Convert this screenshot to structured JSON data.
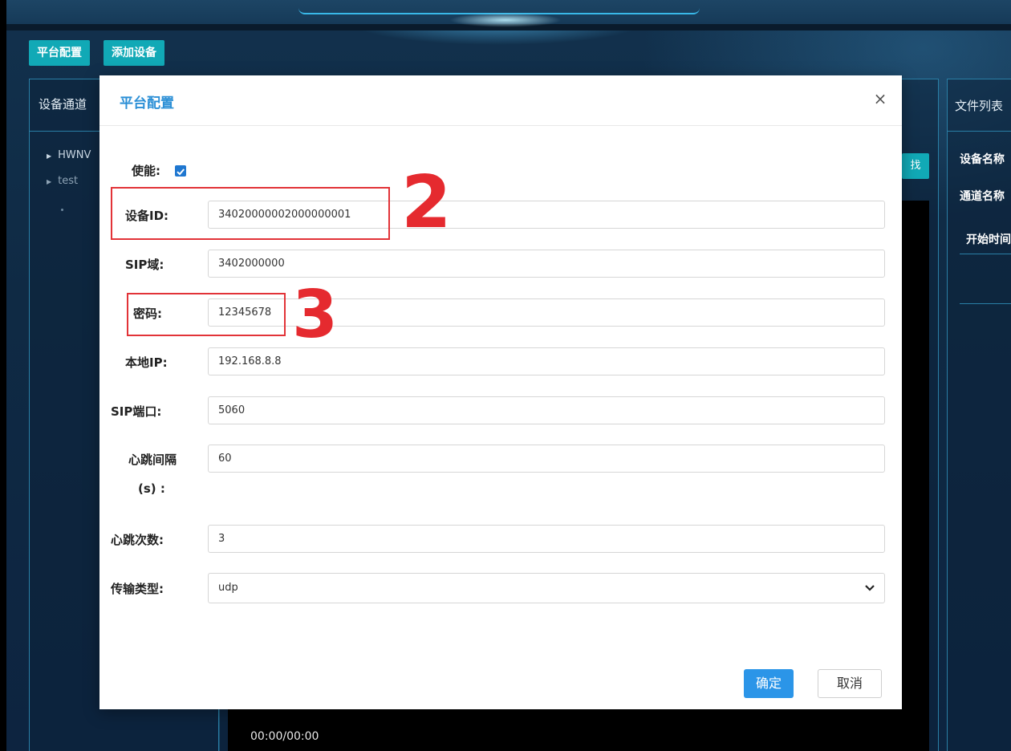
{
  "toolbar": {
    "platform_config": "平台配置",
    "add_device": "添加设备"
  },
  "left_panel": {
    "title": "设备通道",
    "items": [
      "HWNV",
      "test"
    ]
  },
  "right_panel": {
    "title": "文件列表",
    "device_name": "设备名称",
    "channel_name": "通道名称",
    "start_time": "开始时间"
  },
  "search_button": "找",
  "video": {
    "time": "00:00/00:00"
  },
  "modal": {
    "title": "平台配置",
    "close": "×",
    "fields": {
      "enable": {
        "label": "使能:",
        "checked": true
      },
      "device_id": {
        "label": "设备ID:",
        "value": "34020000002000000001"
      },
      "sip_domain": {
        "label": "SIP域:",
        "value": "3402000000"
      },
      "password": {
        "label": "密码:",
        "value": "12345678"
      },
      "local_ip": {
        "label": "本地IP:",
        "value": "192.168.8.8"
      },
      "sip_port": {
        "label": "SIP端口:",
        "value": "5060"
      },
      "heartbeat_interval": {
        "label_line1": "心跳间隔",
        "label_line2": "(s) :",
        "value": "60"
      },
      "heartbeat_count": {
        "label": "心跳次数:",
        "value": "3"
      },
      "transport_type": {
        "label": "传输类型:",
        "value": "udp"
      }
    },
    "ok": "确定",
    "cancel": "取消"
  },
  "annotations": {
    "n2": "2",
    "n3": "3"
  },
  "colors": {
    "accent": "#2b95e8",
    "teal": "#11a9b6",
    "annotation": "#e23338"
  }
}
